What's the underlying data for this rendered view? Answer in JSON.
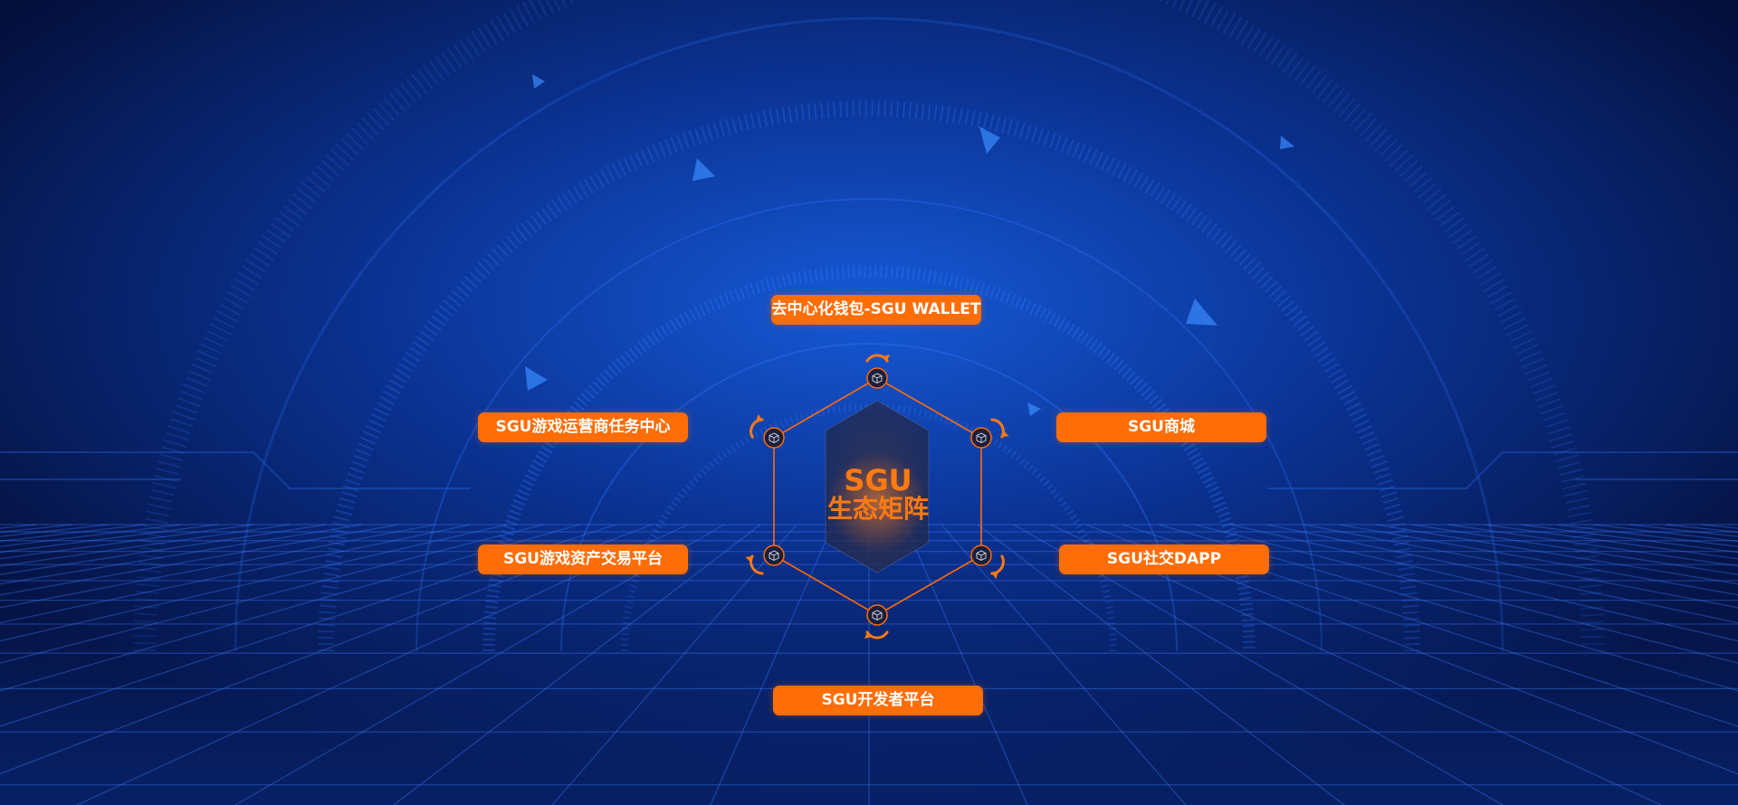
{
  "colors": {
    "background_top": "#0a2f8f",
    "background_bottom": "#04103b",
    "accent": "#ff6d06",
    "hexagon_line": "#ff6d06"
  },
  "center": {
    "line1": "SGU",
    "line2": "生态矩阵"
  },
  "labels": {
    "top": "去中心化钱包-SGU WALLET",
    "upper_left": "SGU游戏运营商任务中心",
    "upper_right": "SGU商城",
    "lower_left": "SGU游戏资产交易平台",
    "lower_right": "SGU社交DAPP",
    "bottom": "SGU开发者平台"
  },
  "icons": [
    "cube-icon",
    "cycle-arrow-icon"
  ]
}
